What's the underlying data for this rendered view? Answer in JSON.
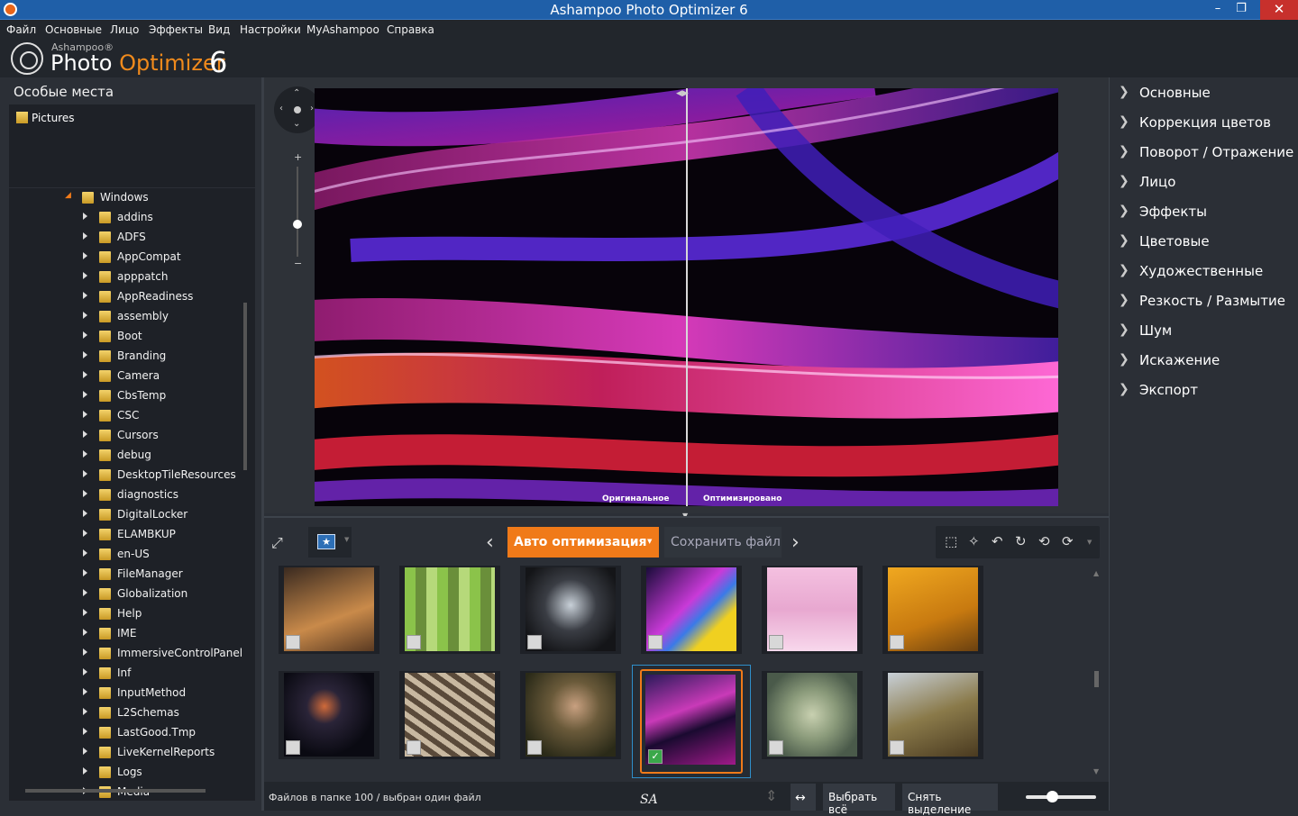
{
  "window": {
    "title": "Ashampoo Photo Optimizer 6",
    "min": "–",
    "max": "❐",
    "close": "✕"
  },
  "menu": [
    "Файл",
    "Основные",
    "Лицо",
    "Эффекты",
    "Вид",
    "Настройки",
    "MyAshampoo",
    "Справка"
  ],
  "logo": {
    "brand": "Ashampoo®",
    "name_a": "Photo ",
    "name_b": "Optimizer",
    "version": "6"
  },
  "sidebar": {
    "header": "Особые места",
    "favorites": [
      "Pictures"
    ],
    "tree_root": "Windows",
    "folders": [
      "addins",
      "ADFS",
      "AppCompat",
      "apppatch",
      "AppReadiness",
      "assembly",
      "Boot",
      "Branding",
      "Camera",
      "CbsTemp",
      "CSC",
      "Cursors",
      "debug",
      "DesktopTileResources",
      "diagnostics",
      "DigitalLocker",
      "ELAMBKUP",
      "en-US",
      "FileManager",
      "Globalization",
      "Help",
      "IME",
      "ImmersiveControlPanel",
      "Inf",
      "InputMethod",
      "L2Schemas",
      "LastGood.Tmp",
      "LiveKernelReports",
      "Logs",
      "Media"
    ]
  },
  "viewer": {
    "caption_left": "Оригинальное",
    "caption_right": "Оптимизировано"
  },
  "toolbar": {
    "auto_label": "Авто оптимизация",
    "save_label": "Сохранить файл"
  },
  "status": {
    "text": "Файлов в папке 100 / выбран один файл",
    "signature": "SA",
    "select_all": "Выбрать всё",
    "deselect": "Снять выделение"
  },
  "right_panel": [
    "Основные",
    "Коррекция цветов",
    "Поворот / Отражение",
    "Лицо",
    "Эффекты",
    "Цветовые",
    "Художественные",
    "Резкость / Размытие",
    "Шум",
    "Искажение",
    "Экспорт"
  ],
  "colors": {
    "accent": "#f07a19",
    "titlebar": "#1f5fa8",
    "panel": "#2b2f36",
    "selection": "#2f8ec9"
  },
  "thumbnails": {
    "selected_index": 9,
    "count_shown": 12
  }
}
